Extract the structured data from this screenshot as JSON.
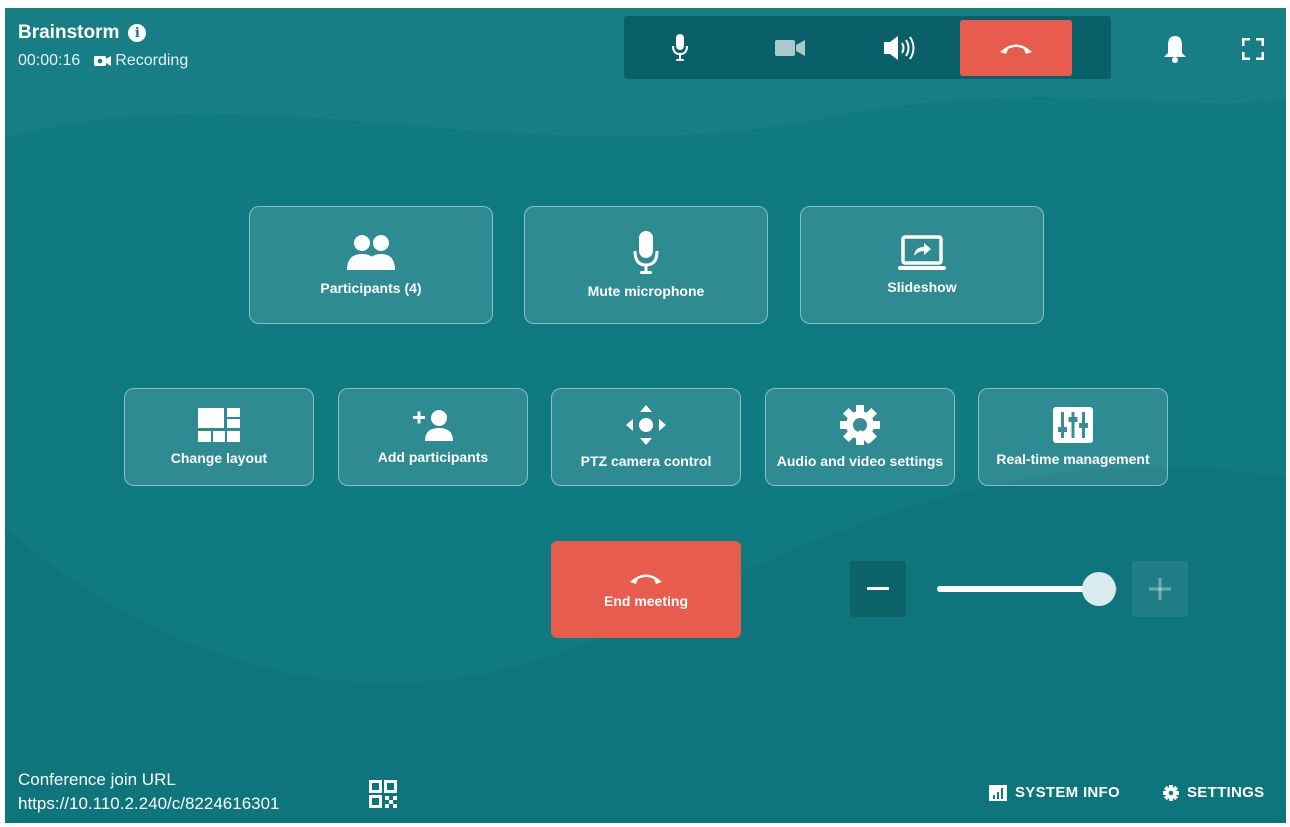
{
  "header": {
    "title": "Brainstorm",
    "elapsed": "00:00:16",
    "recording_label": "Recording"
  },
  "toolbar": {
    "buttons": [
      "microphone-icon",
      "camera-icon",
      "speaker-icon",
      "hang-up-icon"
    ]
  },
  "actions": {
    "participants_label": "Participants (4)",
    "mute_label": "Mute microphone",
    "slideshow_label": "Slideshow",
    "change_layout_label": "Change layout",
    "add_participants_label": "Add participants",
    "ptz_label": "PTZ camera control",
    "av_settings_label": "Audio and video settings",
    "realtime_label": "Real-time management",
    "end_meeting_label": "End meeting"
  },
  "volume": {
    "level": 0.9
  },
  "footer": {
    "join_label": "Conference join URL",
    "join_url": "https://10.110.2.240/c/8224616301",
    "system_info_label": "SYSTEM INFO",
    "settings_label": "SETTINGS"
  },
  "colors": {
    "background": "#0f7a82",
    "danger": "#e85c4d",
    "toolbar": "#0a6068"
  }
}
